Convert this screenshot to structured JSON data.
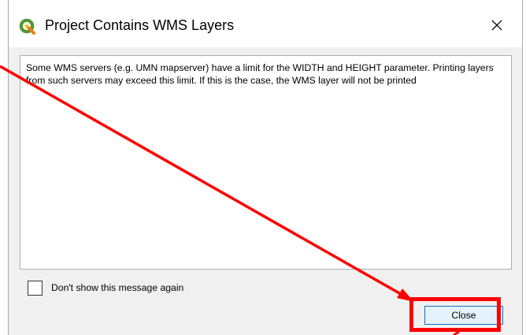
{
  "dialog": {
    "title": "Project Contains WMS Layers",
    "message": "Some WMS servers (e.g. UMN mapserver) have a limit for the WIDTH and HEIGHT parameter. Printing layers from such servers may exceed this limit. If this is the case, the WMS layer will not be printed",
    "dont_show_label": "Don't show this message again",
    "dont_show_checked": false,
    "close_button_label": "Close"
  },
  "icons": {
    "app_icon": "qgis-logo-icon",
    "titlebar_close": "close-icon"
  },
  "colors": {
    "annotation_red": "#ff0000",
    "qgis_green": "#589632",
    "qgis_yellow": "#ee7913",
    "button_focus_border": "#0078d7"
  }
}
